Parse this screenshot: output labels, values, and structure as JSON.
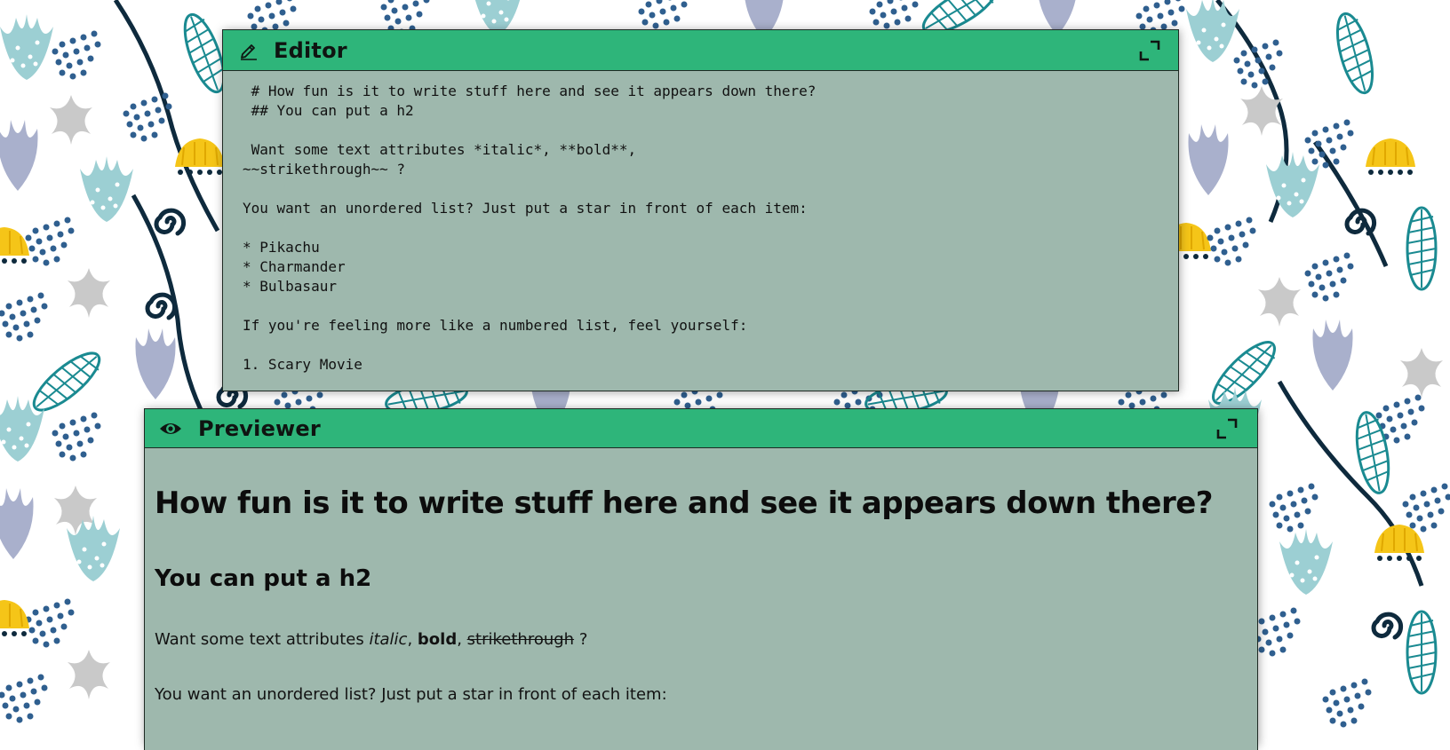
{
  "colors": {
    "header_green": "#2eb57a",
    "panel_sage": "#9eb8ad",
    "leaf_teal": "#1a8a91",
    "petal_light": "#9ccfd3",
    "dot_blue": "#2f5f8f",
    "lavender": "#a9b0cc",
    "flower_yellow": "#f5c518",
    "stem_navy": "#0e2a3d",
    "star_gray": "#c9c9c9"
  },
  "editor": {
    "title": "Editor",
    "icons": {
      "title": "pencil-icon",
      "toggle": "maximize-icon"
    },
    "content": " # How fun is it to write stuff here and see it appears down there?\n ## You can put a h2\n\n Want some text attributes *italic*, **bold**,\n~~strikethrough~~ ?\n\nYou want an unordered list? Just put a star in front of each item:\n\n* Pikachu\n* Charmander\n* Bulbasaur\n\nIf you're feeling more like a numbered list, feel yourself:\n\n1. Scary Movie"
  },
  "previewer": {
    "title": "Previewer",
    "icons": {
      "title": "eye-icon",
      "toggle": "maximize-icon"
    },
    "h1": "How fun is it to write stuff here and see it appears down there?",
    "h2": "You can put a h2",
    "attributes_line": {
      "prefix": "Want some text attributes ",
      "italic": "italic",
      "sep1": ", ",
      "bold": "bold",
      "sep2": ", ",
      "strike": "strikethrough",
      "suffix": " ?"
    },
    "list_intro": "You want an unordered list? Just put a star in front of each item:"
  }
}
